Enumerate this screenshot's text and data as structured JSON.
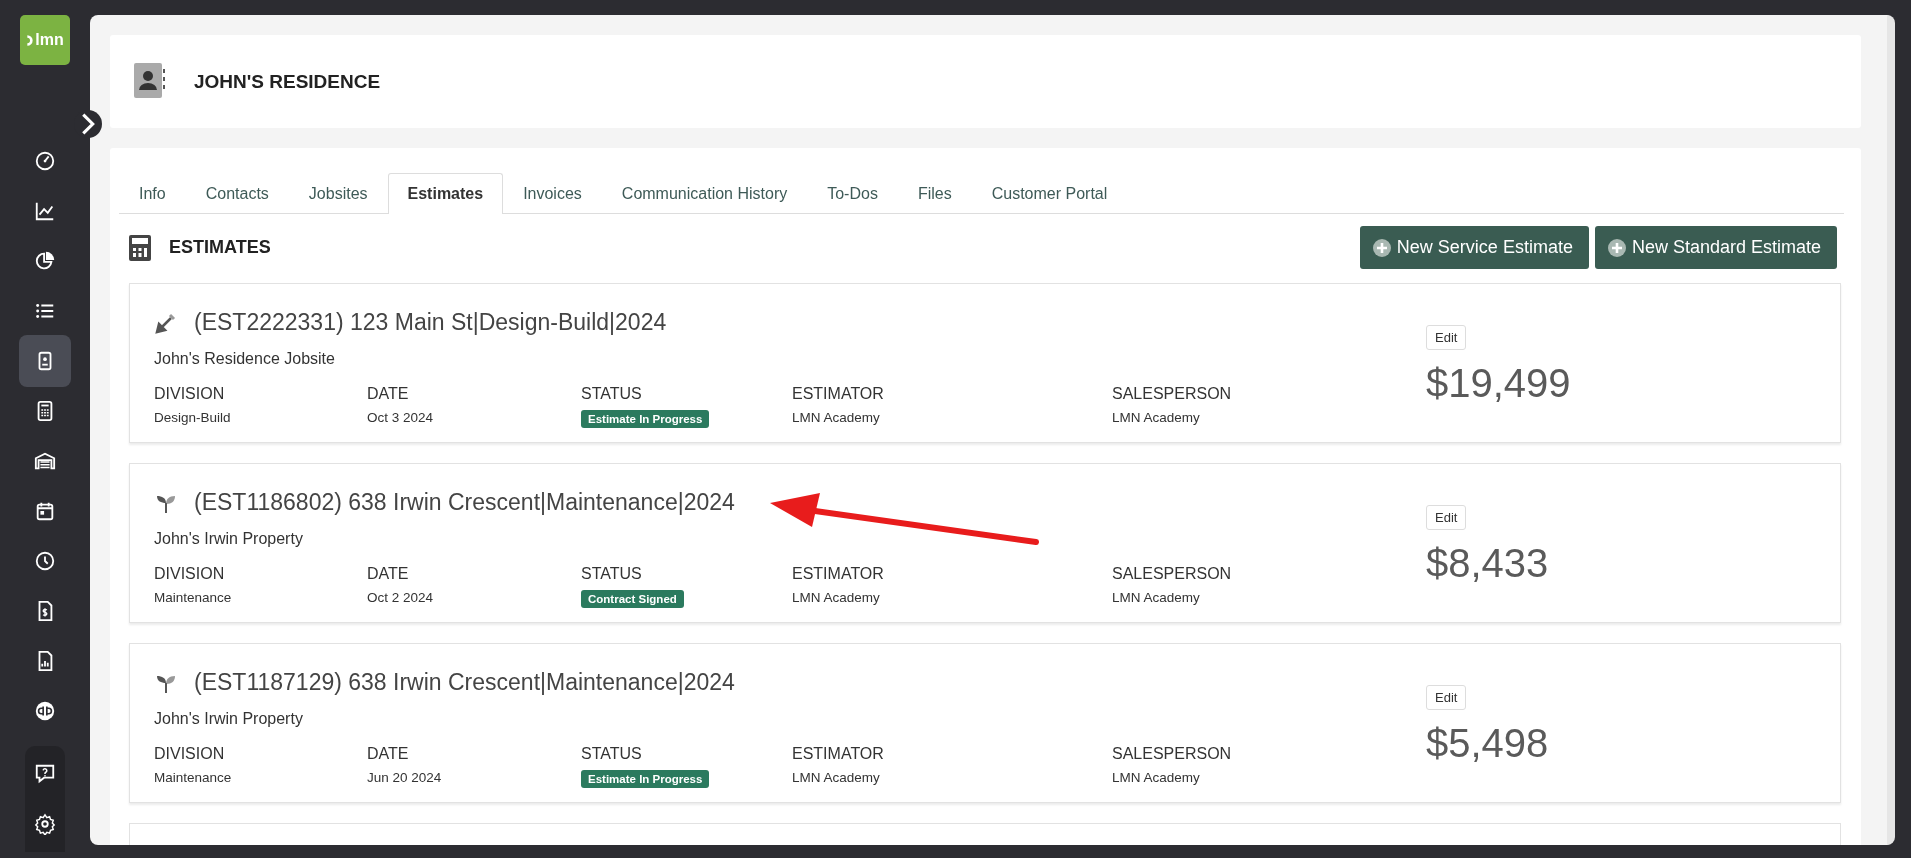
{
  "logo": {
    "text": "lmn"
  },
  "sidebar": {
    "items": [
      {
        "kind": "gauge",
        "selected": false
      },
      {
        "kind": "line-chart",
        "selected": false
      },
      {
        "kind": "pie-chart",
        "selected": false
      },
      {
        "kind": "list",
        "selected": false
      },
      {
        "kind": "contact-card",
        "selected": true
      },
      {
        "kind": "calculator",
        "selected": false
      },
      {
        "kind": "garage",
        "selected": false
      },
      {
        "kind": "calendar",
        "selected": false
      },
      {
        "kind": "clock",
        "selected": false
      },
      {
        "kind": "invoice",
        "selected": false
      },
      {
        "kind": "report",
        "selected": false
      },
      {
        "kind": "qb",
        "selected": false
      }
    ],
    "footer_items": [
      {
        "kind": "help"
      },
      {
        "kind": "settings"
      }
    ]
  },
  "header": {
    "title": "JOHN'S RESIDENCE"
  },
  "tabs": [
    {
      "label": "Info",
      "selected": false
    },
    {
      "label": "Contacts",
      "selected": false
    },
    {
      "label": "Jobsites",
      "selected": false
    },
    {
      "label": "Estimates",
      "selected": true
    },
    {
      "label": "Invoices",
      "selected": false
    },
    {
      "label": "Communication History",
      "selected": false
    },
    {
      "label": "To-Dos",
      "selected": false
    },
    {
      "label": "Files",
      "selected": false
    },
    {
      "label": "Customer Portal",
      "selected": false
    }
  ],
  "section": {
    "title": "ESTIMATES",
    "buttons": [
      "New Service Estimate",
      "New Standard Estimate"
    ]
  },
  "estimates": [
    {
      "kind": "design-build",
      "labels": [
        "DIVISION",
        "DATE",
        "STATUS",
        "ESTIMATOR",
        "SALESPERSON"
      ],
      "title": "(EST2222331) 123 Main St|Design-Build|2024",
      "jobsite": "John's Residence Jobsite",
      "division": "Design-Build",
      "date": "Oct 3 2024",
      "status": "Estimate In Progress",
      "estimator": "LMN Academy",
      "salesperson": "LMN Academy",
      "edit": "Edit",
      "total": "$19,499"
    },
    {
      "kind": "maintenance",
      "labels": [
        "DIVISION",
        "DATE",
        "STATUS",
        "ESTIMATOR",
        "SALESPERSON"
      ],
      "title": "(EST1186802) 638 Irwin Crescent|Maintenance|2024",
      "jobsite": "John's Irwin Property",
      "division": "Maintenance",
      "date": "Oct 2 2024",
      "status": "Contract Signed",
      "estimator": "LMN Academy",
      "salesperson": "LMN Academy",
      "edit": "Edit",
      "total": "$8,433"
    },
    {
      "kind": "maintenance",
      "labels": [
        "DIVISION",
        "DATE",
        "STATUS",
        "ESTIMATOR",
        "SALESPERSON"
      ],
      "title": "(EST1187129) 638 Irwin Crescent|Maintenance|2024",
      "jobsite": "John's Irwin Property",
      "division": "Maintenance",
      "date": "Jun 20 2024",
      "status": "Estimate In Progress",
      "estimator": "LMN Academy",
      "salesperson": "LMN Academy",
      "edit": "Edit",
      "total": "$5,498"
    }
  ],
  "annotation": {
    "kind": "arrow"
  }
}
